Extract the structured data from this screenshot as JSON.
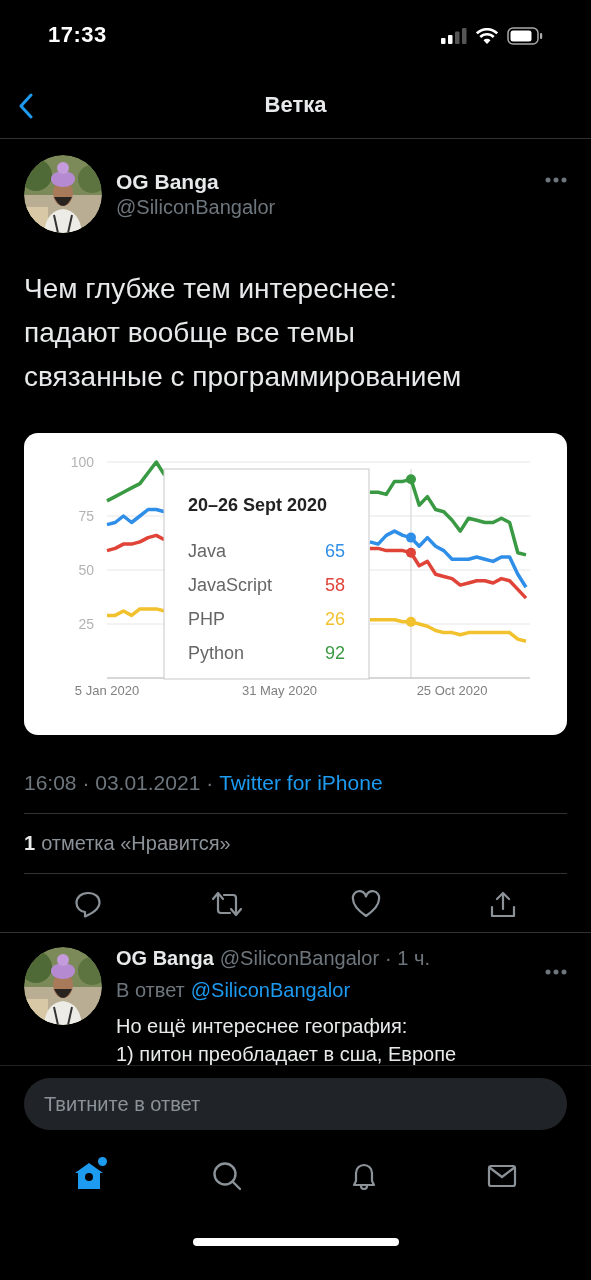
{
  "status_bar": {
    "time": "17:33"
  },
  "header": {
    "title": "Ветка"
  },
  "tweet": {
    "author": {
      "name": "OG Banga",
      "handle": "@SiliconBangalor"
    },
    "text": "Чем глубже тем интереснее: падают вообще все темы связанные с программированием",
    "chart_data": {
      "type": "line",
      "ylim": [
        0,
        100
      ],
      "yticks": [
        25,
        50,
        75,
        100
      ],
      "categories": [
        "5 Jan 2020",
        null,
        null,
        null,
        null,
        null,
        null,
        null,
        null,
        null,
        null,
        null,
        null,
        null,
        null,
        null,
        null,
        null,
        null,
        null,
        null,
        "31 May 2020",
        null,
        null,
        null,
        null,
        null,
        null,
        null,
        null,
        null,
        null,
        null,
        null,
        null,
        null,
        null,
        null,
        null,
        null,
        null,
        null,
        "25 Oct 2020",
        null,
        null,
        null,
        null,
        null,
        null,
        null,
        null,
        null
      ],
      "series": [
        {
          "color": "#2f8ee8",
          "values": [
            71,
            72,
            75,
            72,
            75,
            78,
            78,
            77,
            null,
            null,
            null,
            null,
            null,
            null,
            null,
            null,
            null,
            null,
            null,
            null,
            null,
            null,
            null,
            null,
            null,
            null,
            null,
            null,
            null,
            null,
            null,
            null,
            63,
            62,
            66,
            68,
            66,
            65,
            61,
            65,
            61,
            59,
            55,
            55,
            55,
            56,
            55,
            54,
            56,
            56,
            48,
            42
          ]
        },
        {
          "color": "#e04337",
          "values": [
            59,
            60,
            62,
            62,
            63,
            65,
            66,
            64,
            null,
            null,
            null,
            null,
            null,
            null,
            null,
            null,
            null,
            null,
            null,
            null,
            null,
            null,
            null,
            null,
            null,
            null,
            null,
            null,
            null,
            null,
            null,
            null,
            60,
            60,
            59,
            59,
            59,
            58,
            52,
            54,
            48,
            47,
            46,
            43,
            44,
            45,
            45,
            44,
            46,
            45,
            41,
            37
          ]
        },
        {
          "color": "#f2c12e",
          "values": [
            29,
            29,
            31,
            29,
            32,
            32,
            32,
            31,
            null,
            null,
            null,
            null,
            null,
            null,
            null,
            null,
            null,
            null,
            null,
            null,
            null,
            null,
            null,
            null,
            null,
            null,
            null,
            null,
            null,
            null,
            null,
            null,
            27,
            27,
            27,
            27,
            26,
            26,
            25,
            24,
            22,
            21,
            21,
            20,
            21,
            21,
            21,
            21,
            21,
            21,
            18,
            17
          ]
        },
        {
          "color": "#3a9a43",
          "values": [
            82,
            84,
            86,
            88,
            90,
            95,
            100,
            94,
            null,
            null,
            null,
            null,
            null,
            null,
            null,
            null,
            null,
            null,
            null,
            null,
            null,
            null,
            null,
            null,
            null,
            null,
            null,
            null,
            null,
            null,
            null,
            null,
            86,
            86,
            85,
            91,
            91,
            92,
            80,
            84,
            78,
            77,
            73,
            68,
            74,
            73,
            72,
            72,
            74,
            72,
            58,
            57
          ]
        }
      ],
      "grid": true
    },
    "tooltip": {
      "title": "20–26 Sept 2020",
      "rows": [
        {
          "label": "Java",
          "value": "65"
        },
        {
          "label": "JavaScript",
          "value": "58"
        },
        {
          "label": "PHP",
          "value": "26"
        },
        {
          "label": "Python",
          "value": "92"
        }
      ]
    },
    "timestamp": "16:08 · 03.01.2021 ·",
    "source": "Twitter for iPhone",
    "likes": {
      "count": "1",
      "label": "отметка «Нравится»"
    }
  },
  "reply": {
    "name": "OG Banga",
    "handle": "@SiliconBangalor",
    "time": "· 1 ч.",
    "in_reply_label": "В ответ",
    "in_reply_to": "@SiliconBangalor",
    "lines": [
      "Но ещё интереснее география:",
      "1) питон преобладает в сша, Европе"
    ]
  },
  "composer": {
    "placeholder": "Твитните в ответ"
  },
  "tab_bar": {
    "items": [
      {
        "kind": "home",
        "selected": true,
        "badge": true
      },
      {
        "kind": "search",
        "selected": false
      },
      {
        "kind": "notifications",
        "selected": false
      },
      {
        "kind": "messages",
        "selected": false
      }
    ]
  }
}
